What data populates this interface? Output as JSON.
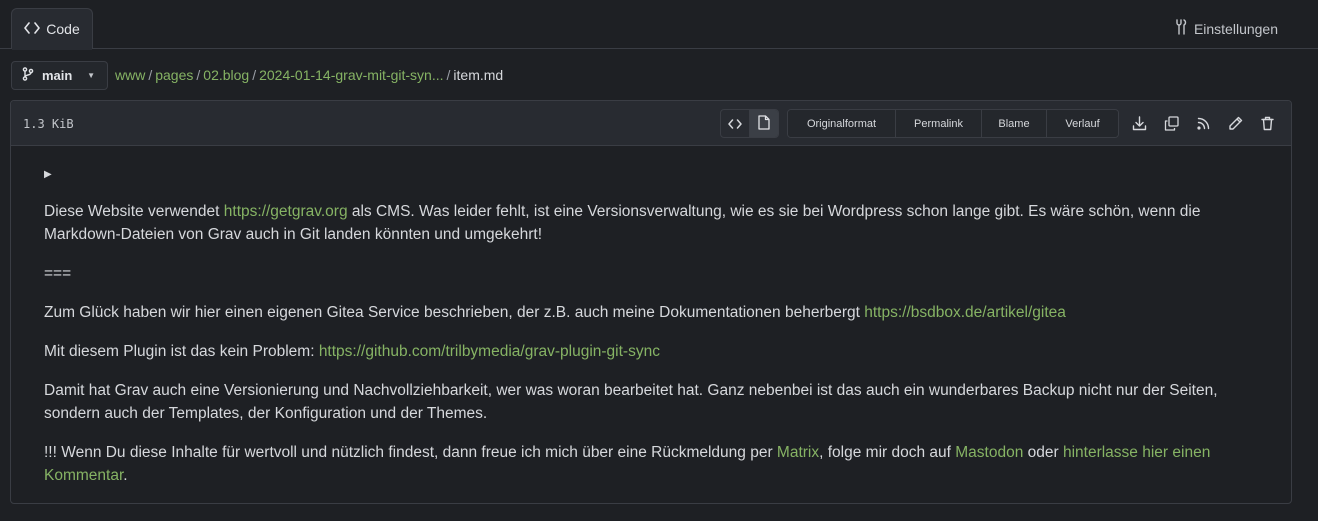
{
  "tabs": {
    "code_label": "Code",
    "settings_label": "Einstellungen"
  },
  "branch": {
    "name": "main"
  },
  "breadcrumb": {
    "segments": [
      "www",
      "pages",
      "02.blog",
      "2024-01-14-grav-mit-git-syn..."
    ],
    "file": "item.md",
    "separator": "/"
  },
  "file": {
    "size": "1.3 KiB",
    "actions": [
      "Originalformat",
      "Permalink",
      "Blame",
      "Verlauf"
    ]
  },
  "content": {
    "toggle": "▶",
    "p1_a": "Diese Website verwendet ",
    "p1_link": "https://getgrav.org",
    "p1_b": " als CMS. Was leider fehlt, ist eine Versionsverwaltung, wie es sie bei Wordpress schon lange gibt. Es wäre schön, wenn die Markdown-Dateien von Grav auch in Git landen könnten und umgekehrt!",
    "p2": "===",
    "p3_a": "Zum Glück haben wir hier einen eigenen Gitea Service beschrieben, der z.B. auch meine Dokumentationen beherbergt ",
    "p3_link": "https://bsdbox.de/artikel/gitea",
    "p4_a": "Mit diesem Plugin ist das kein Problem: ",
    "p4_link": "https://github.com/trilbymedia/grav-plugin-git-sync",
    "p5": "Damit hat Grav auch eine Versionierung und Nachvollziehbarkeit, wer was woran bearbeitet hat. Ganz nebenbei ist das auch ein wunderbares Backup nicht nur der Seiten, sondern auch der Templates, der Konfiguration und der Themes.",
    "p6_a": "!!! Wenn Du diese Inhalte für wertvoll und nützlich findest, dann freue ich mich über eine Rückmeldung per ",
    "p6_link1": "Matrix",
    "p6_b": ", folge mir doch auf ",
    "p6_link2": "Mastodon",
    "p6_c": " oder ",
    "p6_link3": "hinterlasse hier einen Kommentar",
    "p6_d": "."
  },
  "colors": {
    "background": "#1e2024",
    "panel": "#282b31",
    "border": "#3a3d44",
    "link": "#86b364",
    "text": "#d6d8dc"
  },
  "icons": [
    "code-icon",
    "tools-icon",
    "branch-icon",
    "source-view-icon",
    "rendered-view-icon",
    "download-icon",
    "copy-icon",
    "rss-icon",
    "edit-icon",
    "trash-icon"
  ]
}
